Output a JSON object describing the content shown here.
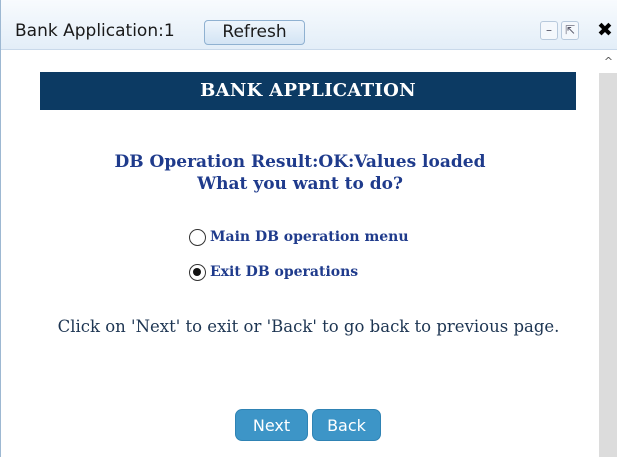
{
  "window": {
    "title": "Bank Application:1",
    "refresh_label": "Refresh",
    "minimize_symbol": "–",
    "popout_symbol": "⇱",
    "close_symbol": "✖"
  },
  "scrollbar": {
    "up_arrow": "^"
  },
  "page": {
    "banner": "BANK APPLICATION",
    "result_line_1": "DB Operation Result:OK:Values loaded",
    "result_line_2": "What you want to do?",
    "options": [
      {
        "label": "Main DB operation menu",
        "selected": false
      },
      {
        "label": "Exit DB operations",
        "selected": true
      }
    ],
    "instruction": "Click on 'Next' to exit or 'Back' to go back to previous page.",
    "next_label": "Next",
    "back_label": "Back"
  },
  "colors": {
    "banner_bg": "#0c3a63",
    "accent_text": "#1f3b8c",
    "button_bg": "#3d95c7"
  }
}
